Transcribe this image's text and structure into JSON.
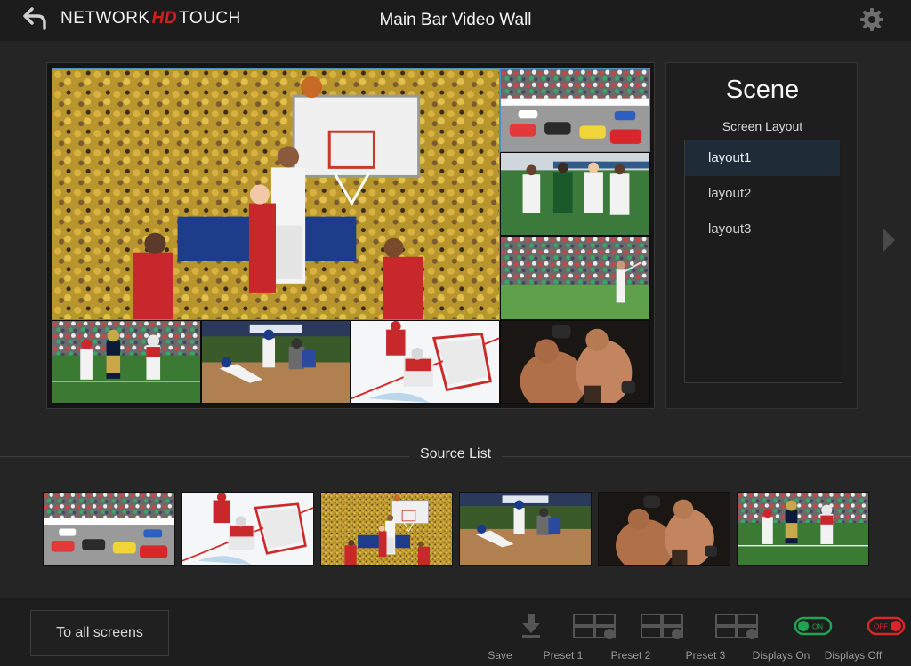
{
  "header": {
    "logo_left": "NETWORK",
    "logo_mid": "HD",
    "logo_right": "TOUCH",
    "title": "Main Bar Video Wall"
  },
  "scene": {
    "title": "Scene",
    "screen_layout_label": "Screen Layout",
    "layouts": [
      {
        "label": "layout1",
        "selected": true
      },
      {
        "label": "layout2",
        "selected": false
      },
      {
        "label": "layout3",
        "selected": false
      }
    ]
  },
  "source_list": {
    "title": "Source List",
    "sources": [
      "racing",
      "hockey",
      "basketball",
      "baseball",
      "mma",
      "football"
    ]
  },
  "wall": {
    "tiles": [
      "basketball",
      "racing",
      "soccer",
      "golf",
      "football",
      "baseball",
      "hockey",
      "mma"
    ]
  },
  "footer": {
    "to_all_screens": "To all screens",
    "save": "Save",
    "preset1": "Preset 1",
    "preset2": "Preset 2",
    "preset3": "Preset 3",
    "displays_on": "Displays On",
    "displays_off": "Displays Off",
    "on_text": "ON",
    "off_text": "OFF"
  },
  "colors": {
    "accent_red": "#d21f1f",
    "on_green": "#21a353",
    "off_red": "#d8262b",
    "selected_blue": "#1f2b36"
  }
}
